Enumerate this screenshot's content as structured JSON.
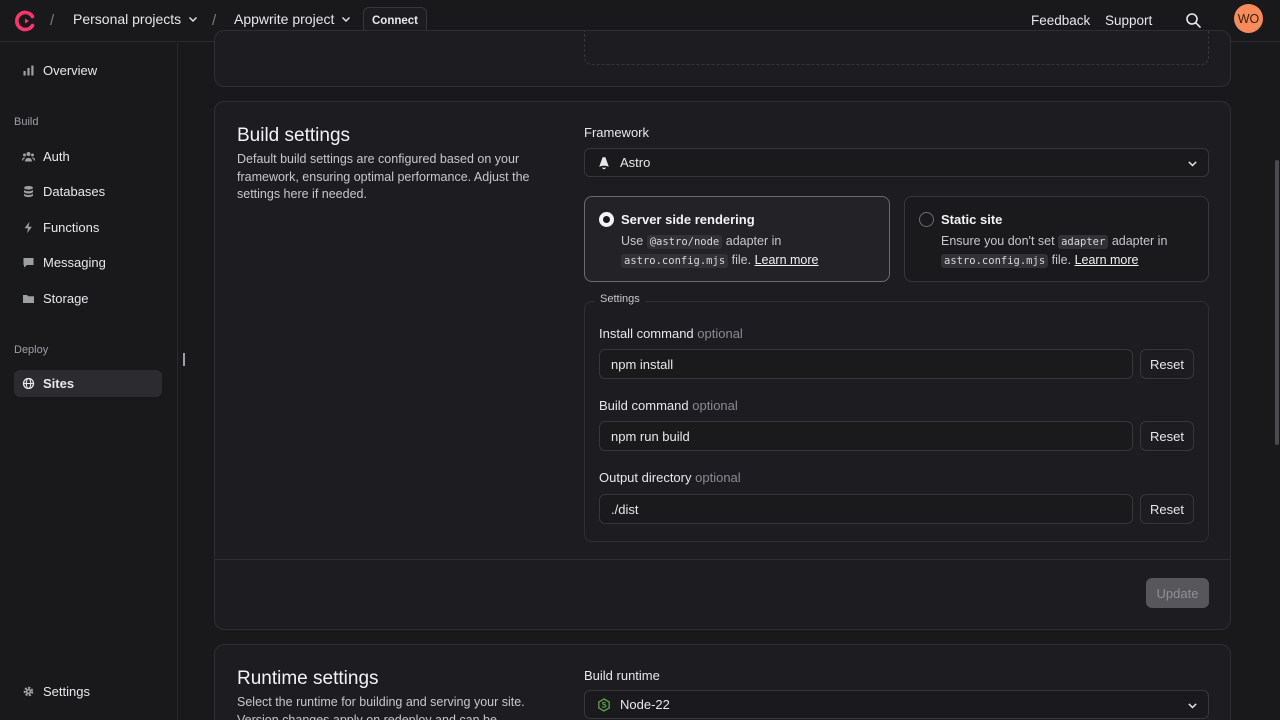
{
  "topbar": {
    "breadcrumbs": [
      {
        "label": "Personal projects"
      },
      {
        "label": "Appwrite project"
      }
    ],
    "connect_label": "Connect",
    "feedback_label": "Feedback",
    "support_label": "Support",
    "avatar_initials": "WO",
    "brand_color": "#fd366e"
  },
  "sidebar": {
    "overview_label": "Overview",
    "build_section": "Build",
    "build_items": [
      {
        "label": "Auth",
        "icon": "users-icon"
      },
      {
        "label": "Databases",
        "icon": "database-icon"
      },
      {
        "label": "Functions",
        "icon": "lightning-icon"
      },
      {
        "label": "Messaging",
        "icon": "chat-icon"
      },
      {
        "label": "Storage",
        "icon": "folder-icon"
      }
    ],
    "deploy_section": "Deploy",
    "sites_label": "Sites",
    "settings_label": "Settings"
  },
  "build_settings": {
    "title": "Build settings",
    "description": "Default build settings are configured based on your framework, ensuring optimal performance. Adjust the settings here if needed.",
    "framework_label": "Framework",
    "framework_value": "Astro",
    "ssr": {
      "title": "Server side rendering",
      "desc_use": "Use",
      "code_adapter": "@astro/node",
      "desc_adapter_in": "adapter in",
      "code_config": "astro.config.mjs",
      "desc_file": "file.",
      "learn_more": "Learn more",
      "selected": true
    },
    "static": {
      "title": "Static site",
      "desc_ensure": "Ensure you don't set",
      "code_adapter": "adapter",
      "desc_adapter_in": "adapter in",
      "code_config": "astro.config.mjs",
      "desc_file": "file.",
      "learn_more": "Learn more",
      "selected": false
    },
    "settings_legend": "Settings",
    "optional_label": "optional",
    "reset_label": "Reset",
    "install": {
      "label": "Install command",
      "value": "npm install"
    },
    "build": {
      "label": "Build command",
      "value": "npm run build"
    },
    "output": {
      "label": "Output directory",
      "value": "./dist"
    },
    "update_label": "Update"
  },
  "runtime_settings": {
    "title": "Runtime settings",
    "description": "Select the runtime for building and serving your site. Version changes apply on redeploy and can be",
    "runtime_label": "Build runtime",
    "runtime_value": "Node-22"
  }
}
